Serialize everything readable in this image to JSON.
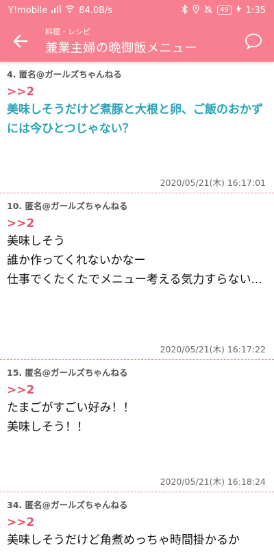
{
  "status_bar": {
    "carrier": "Y!mobile",
    "speed": "84.0B/s",
    "battery": "49",
    "time": "1:35"
  },
  "app_bar": {
    "category": "料理・レシピ",
    "title": "兼業主婦の晩御飯メニュー",
    "back_icon": "arrow-left-icon",
    "comment_icon": "speech-bubble-icon"
  },
  "posts": [
    {
      "header": "4. 匿名@ガールズちゃんねる",
      "reply": ">>2",
      "body": "美味しそうだけど煮豚と大根と卵、ご飯のおかずには今ひとつじゃない？",
      "timestamp": "2020/05/21(木) 16:17:01"
    },
    {
      "header": "10. 匿名@ガールズちゃんねる",
      "reply": ">>2",
      "body": "美味しそう\n誰か作ってくれないかなー\n仕事でくたくたでメニュー考える気力すらない...",
      "timestamp": "2020/05/21(木) 16:17:22"
    },
    {
      "header": "15. 匿名@ガールズちゃんねる",
      "reply": ">>2",
      "body": "たまごがすごい好み！！\n美味しそう！！",
      "timestamp": "2020/05/21(木) 16:18:24"
    },
    {
      "header": "34. 匿名@ガールズちゃんねる",
      "reply": ">>2",
      "body": "美味しそうだけど角煮めっちゃ時間掛かるか"
    }
  ],
  "colors": {
    "header_bg": "#f77f8f",
    "reply_ref": "#e0566c",
    "highlight_text": "#2aa3b7"
  }
}
